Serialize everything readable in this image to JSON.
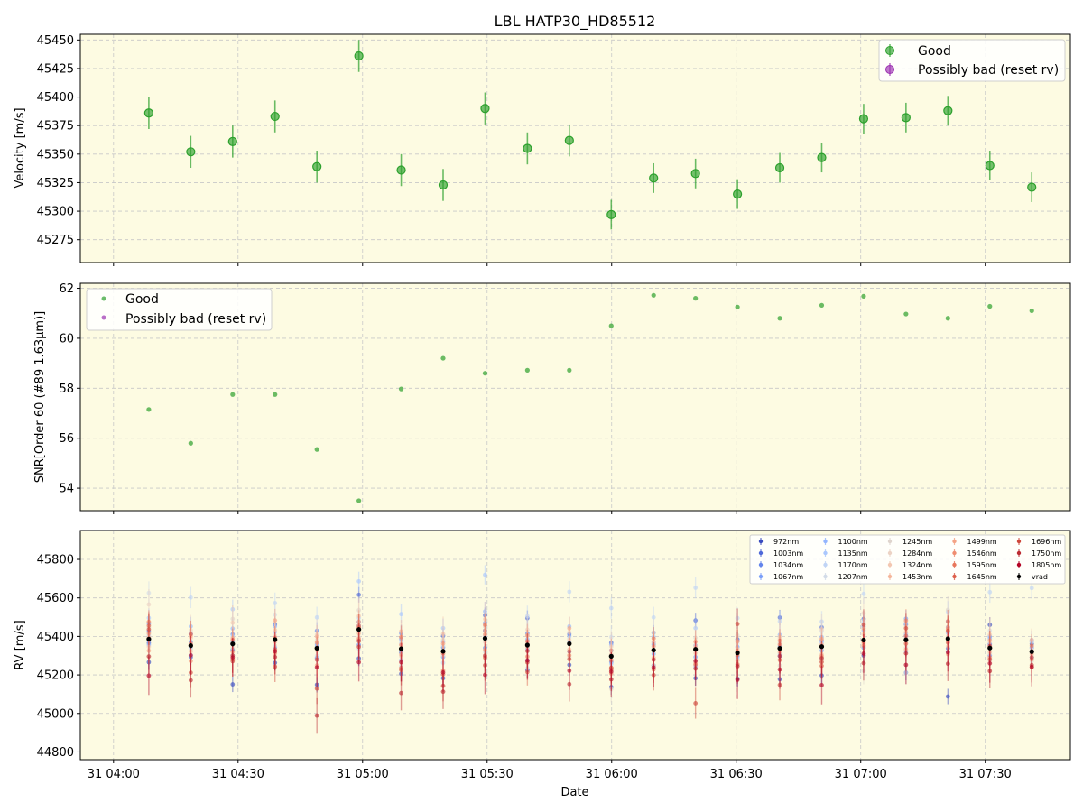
{
  "title": "LBL HATP30_HD85512",
  "xlabel": "Date",
  "x_ticks": [
    "31 04:00",
    "31 04:30",
    "31 05:00",
    "31 05:30",
    "31 06:00",
    "31 06:30",
    "31 07:00",
    "31 07:30"
  ],
  "x_tick_minutes": [
    0,
    30,
    60,
    90,
    120,
    150,
    180,
    210
  ],
  "colors": {
    "good": "#2ca02c",
    "bad": "#9b30b0",
    "panel_bg": "#fdfbe2",
    "grid": "#c8c8c8",
    "vrad": "#000000"
  },
  "chart_data": [
    {
      "type": "scatter",
      "ylabel": "Velocity [m/s]",
      "ylim": [
        45255,
        45455
      ],
      "y_ticks": [
        45275,
        45300,
        45325,
        45350,
        45375,
        45400,
        45425,
        45450
      ],
      "legend": {
        "position": "top-right",
        "entries": [
          "Good",
          "Possibly bad (reset rv)"
        ]
      },
      "x_minutes": [
        8.5,
        18.6,
        28.7,
        38.9,
        49.0,
        59.1,
        69.3,
        79.4,
        89.5,
        99.7,
        109.8,
        119.9,
        130.1,
        140.2,
        150.3,
        160.5,
        170.6,
        180.7,
        190.9,
        201.0,
        211.1,
        221.2
      ],
      "series": [
        {
          "name": "Good",
          "values": [
            45386,
            45352,
            45361,
            45383,
            45339,
            45336,
            45323,
            45390,
            45355,
            45362,
            45297,
            45329,
            45333,
            45315,
            45338,
            45347,
            45381,
            45382,
            45388,
            45340,
            45321
          ],
          "errors": [
            14,
            14,
            14,
            14,
            14,
            14,
            13,
            14,
            14,
            13,
            13,
            13,
            13,
            13,
            13,
            12,
            13,
            13,
            13,
            13,
            13
          ]
        },
        {
          "name": "Possibly bad (reset rv)",
          "values": [],
          "errors": []
        }
      ]
    },
    {
      "type": "scatter",
      "ylabel": "SNR[Order 60 (#89 1.63μm)]",
      "ylim": [
        53.1,
        62.2
      ],
      "y_ticks": [
        54,
        56,
        58,
        60,
        62
      ],
      "legend": {
        "position": "top-left",
        "entries": [
          "Good",
          "Possibly bad (reset rv)"
        ]
      },
      "series": [
        {
          "name": "Good",
          "values": [
            57.15,
            55.8,
            57.75,
            57.75,
            55.55,
            53.5,
            57.97,
            59.2,
            58.6,
            58.72,
            58.72,
            60.5,
            61.72,
            61.6,
            61.25,
            60.8,
            61.32,
            61.68,
            60.97,
            60.8,
            61.28,
            61.1
          ]
        },
        {
          "name": "Possibly bad (reset rv)",
          "values": []
        }
      ]
    },
    {
      "type": "scatter",
      "ylabel": "RV [m/s]",
      "ylim": [
        44760,
        45950
      ],
      "y_ticks": [
        44800,
        45000,
        45200,
        45400,
        45600,
        45800
      ],
      "legend": {
        "position": "top-right",
        "entries": [
          "972nm",
          "1003nm",
          "1034nm",
          "1067nm",
          "1100nm",
          "1135nm",
          "1170nm",
          "1207nm",
          "1245nm",
          "1284nm",
          "1324nm",
          "1453nm",
          "1499nm",
          "1546nm",
          "1595nm",
          "1645nm",
          "1696nm",
          "1750nm",
          "1805nm",
          "vrad"
        ]
      },
      "band_colors": [
        "#3b4cc0",
        "#4f69d9",
        "#6485ec",
        "#7b9ff9",
        "#93b5fe",
        "#aac7fd",
        "#c0d4f5",
        "#d2dbe8",
        "#dfd5ce",
        "#ecd3c5",
        "#f3c7b1",
        "#f5b69b",
        "#f4a385",
        "#ef8d71",
        "#e8765c",
        "#dd5f4b",
        "#ce473c",
        "#bb2b33",
        "#b40426"
      ],
      "vrad": [
        45386,
        45352,
        45361,
        45383,
        45339,
        45436,
        45336,
        45323,
        45390,
        45355,
        45362,
        45297,
        45329,
        45333,
        45315,
        45338,
        45347,
        45381,
        45382,
        45388,
        45340,
        45321
      ],
      "vrad_err": [
        12,
        12,
        12,
        12,
        12,
        12,
        12,
        12,
        12,
        12,
        12,
        11,
        11,
        11,
        11,
        11,
        11,
        11,
        11,
        11,
        11,
        11
      ],
      "band_offsets": [
        [
          -120,
          -20,
          40,
          80,
          -30,
          110,
          20,
          240,
          60,
          180,
          -40,
          10,
          -60,
          30,
          90,
          70,
          50,
          -90,
          -190
        ],
        [
          -60,
          60,
          20,
          -50,
          100,
          -10,
          250,
          70,
          -20,
          80,
          40,
          -30,
          50,
          -80,
          10,
          60,
          -140,
          -180,
          -50
        ],
        [
          -210,
          -30,
          50,
          10,
          80,
          180,
          40,
          -60,
          130,
          -20,
          110,
          0,
          30,
          -40,
          20,
          -80,
          -90,
          -60,
          -70
        ],
        [
          -120,
          80,
          0,
          -40,
          70,
          40,
          190,
          130,
          -30,
          20,
          50,
          -10,
          100,
          -70,
          10,
          -50,
          -140,
          -90,
          -60
        ],
        [
          -190,
          -50,
          90,
          20,
          10,
          -60,
          160,
          -40,
          40,
          70,
          -10,
          60,
          -90,
          30,
          0,
          -60,
          -210,
          -350,
          -100
        ],
        [
          -150,
          180,
          -80,
          40,
          20,
          250,
          60,
          -100,
          100,
          -40,
          70,
          -20,
          40,
          -50,
          20,
          10,
          -90,
          -60,
          -170
        ],
        [
          -130,
          -20,
          80,
          50,
          -60,
          180,
          30,
          -90,
          20,
          -40,
          0,
          90,
          -30,
          20,
          60,
          -100,
          -110,
          -230,
          -70
        ],
        [
          -140,
          80,
          20,
          -30,
          50,
          120,
          -60,
          30,
          60,
          -20,
          90,
          0,
          40,
          -100,
          -10,
          -120,
          -180,
          -210,
          -110
        ],
        [
          40,
          120,
          -50,
          80,
          140,
          330,
          10,
          -70,
          60,
          -20,
          100,
          40,
          -60,
          20,
          70,
          -100,
          -140,
          -90,
          -190
        ],
        [
          -130,
          140,
          60,
          -80,
          30,
          -20,
          150,
          -120,
          50,
          80,
          10,
          -10,
          50,
          -60,
          20,
          -140,
          -90,
          -30,
          -80
        ],
        [
          -110,
          50,
          -40,
          40,
          90,
          10,
          270,
          30,
          -70,
          60,
          20,
          -30,
          80,
          0,
          -60,
          -40,
          -80,
          -210,
          -140
        ],
        [
          -160,
          70,
          -30,
          30,
          60,
          -40,
          250,
          100,
          -170,
          50,
          10,
          -60,
          30,
          -90,
          -20,
          -70,
          -60,
          -120,
          -80
        ],
        [
          -80,
          90,
          30,
          -20,
          40,
          70,
          170,
          20,
          90,
          -80,
          0,
          40,
          -40,
          20,
          60,
          -100,
          -130,
          -50,
          -90
        ],
        [
          -150,
          150,
          20,
          -40,
          -90,
          110,
          320,
          -60,
          60,
          20,
          -20,
          10,
          -70,
          40,
          0,
          -80,
          -280,
          -100,
          -60
        ],
        [
          -135,
          70,
          -20,
          30,
          60,
          -30,
          180,
          50,
          90,
          -70,
          20,
          -40,
          10,
          60,
          -10,
          -60,
          150,
          -70,
          -140
        ],
        [
          -160,
          160,
          -40,
          10,
          70,
          -30,
          140,
          30,
          -90,
          50,
          60,
          0,
          -20,
          40,
          20,
          -60,
          -190,
          -40,
          -110
        ],
        [
          -150,
          100,
          30,
          -20,
          50,
          20,
          130,
          80,
          -60,
          90,
          -40,
          10,
          40,
          -50,
          0,
          -100,
          -80,
          -60,
          -200
        ],
        [
          -80,
          110,
          -40,
          70,
          50,
          90,
          240,
          100,
          -160,
          140,
          30,
          -20,
          60,
          0,
          -30,
          -10,
          80,
          -120,
          -70
        ],
        [
          -170,
          80,
          20,
          110,
          30,
          -60,
          90,
          -170,
          -40,
          70,
          0,
          40,
          -50,
          100,
          20,
          -20,
          60,
          -70,
          -130
        ],
        [
          -300,
          -50,
          60,
          30,
          90,
          -70,
          140,
          30,
          150,
          10,
          -40,
          60,
          -80,
          50,
          90,
          -20,
          40,
          -130,
          -70
        ],
        [
          120,
          20,
          -40,
          60,
          50,
          -60,
          290,
          90,
          -30,
          30,
          70,
          -20,
          40,
          -50,
          0,
          -60,
          10,
          -120,
          -80
        ],
        [
          40,
          20,
          -30,
          50,
          60,
          20,
          330,
          50,
          -50,
          10,
          -20,
          60,
          -10,
          -40,
          30,
          -80,
          -30,
          -70,
          -80
        ]
      ],
      "band_errors": [
        40,
        40,
        45,
        45,
        50,
        50,
        55,
        60,
        70,
        80,
        90,
        60,
        60,
        60,
        60,
        70,
        80,
        90,
        100
      ]
    }
  ]
}
